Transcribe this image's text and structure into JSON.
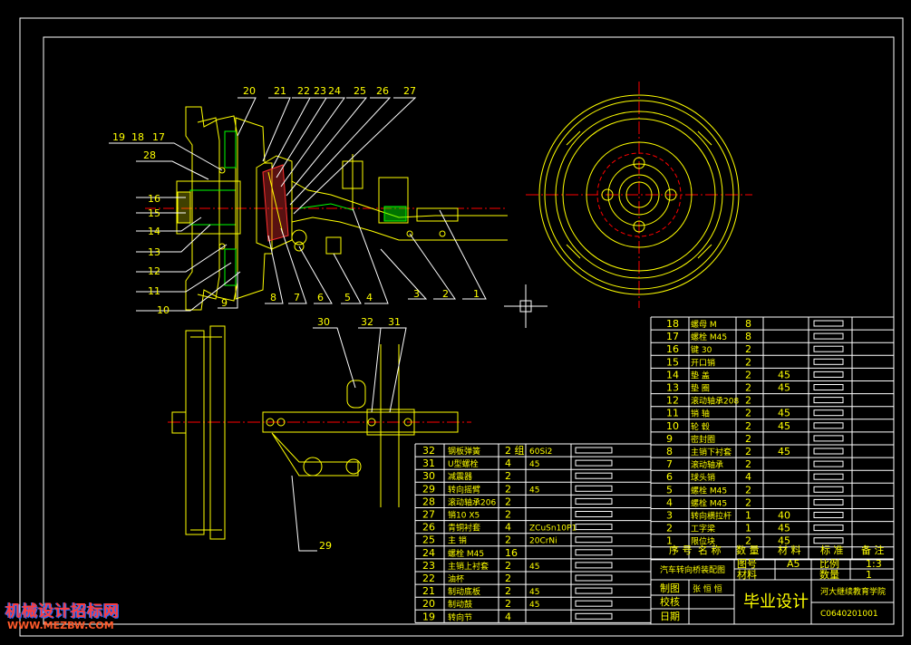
{
  "drawing": {
    "balloons_top": [
      "20",
      "21",
      "22",
      "23",
      "24",
      "25",
      "26",
      "27"
    ],
    "balloons_left": [
      "19",
      "18",
      "17",
      "28",
      "16",
      "15",
      "14",
      "13",
      "12",
      "11",
      "10"
    ],
    "balloons_bottom": [
      "9",
      "8",
      "7",
      "6",
      "5",
      "4",
      "3",
      "2",
      "1"
    ],
    "balloons_lower": [
      "30",
      "32",
      "31",
      "29"
    ]
  },
  "parts_right": [
    {
      "no": "18",
      "name": "螺母 M",
      "qty": "8",
      "mat": "",
      "std": "",
      "note": ""
    },
    {
      "no": "17",
      "name": "螺栓 M45",
      "qty": "8",
      "mat": "",
      "std": "",
      "note": ""
    },
    {
      "no": "16",
      "name": "键 30",
      "qty": "2",
      "mat": "",
      "std": "",
      "note": ""
    },
    {
      "no": "15",
      "name": "开口销",
      "qty": "2",
      "mat": "",
      "std": "",
      "note": ""
    },
    {
      "no": "14",
      "name": "垫 盖",
      "qty": "2",
      "mat": "45",
      "std": "",
      "note": ""
    },
    {
      "no": "13",
      "name": "垫 圈",
      "qty": "2",
      "mat": "45",
      "std": "",
      "note": ""
    },
    {
      "no": "12",
      "name": "滚动轴承208",
      "qty": "2",
      "mat": "",
      "std": "",
      "note": ""
    },
    {
      "no": "11",
      "name": "销 轴",
      "qty": "2",
      "mat": "45",
      "std": "",
      "note": ""
    },
    {
      "no": "10",
      "name": "轮 毂",
      "qty": "2",
      "mat": "45",
      "std": "",
      "note": ""
    },
    {
      "no": "9",
      "name": "密封圈",
      "qty": "2",
      "mat": "",
      "std": "",
      "note": ""
    },
    {
      "no": "8",
      "name": "主销下衬套",
      "qty": "2",
      "mat": "45",
      "std": "",
      "note": ""
    },
    {
      "no": "7",
      "name": "滚动轴承",
      "qty": "2",
      "mat": "",
      "std": "",
      "note": ""
    },
    {
      "no": "6",
      "name": "球头销",
      "qty": "4",
      "mat": "",
      "std": "",
      "note": ""
    },
    {
      "no": "5",
      "name": "螺栓 M45",
      "qty": "2",
      "mat": "",
      "std": "",
      "note": ""
    },
    {
      "no": "4",
      "name": "螺栓 M45",
      "qty": "2",
      "mat": "",
      "std": "",
      "note": ""
    },
    {
      "no": "3",
      "name": "转向横拉杆",
      "qty": "1",
      "mat": "40",
      "std": "",
      "note": ""
    },
    {
      "no": "2",
      "name": "工字梁",
      "qty": "1",
      "mat": "45",
      "std": "",
      "note": ""
    },
    {
      "no": "1",
      "name": "限位块",
      "qty": "2",
      "mat": "45",
      "std": "",
      "note": ""
    }
  ],
  "parts_left": [
    {
      "no": "32",
      "name": "钢板弹簧",
      "qty": "2 组",
      "mat": "60Si2"
    },
    {
      "no": "31",
      "name": "U型螺栓",
      "qty": "4",
      "mat": "45"
    },
    {
      "no": "30",
      "name": "减震器",
      "qty": "2",
      "mat": ""
    },
    {
      "no": "29",
      "name": "转向摇臂",
      "qty": "2",
      "mat": "45"
    },
    {
      "no": "28",
      "name": "滚动轴承206",
      "qty": "2",
      "mat": ""
    },
    {
      "no": "27",
      "name": "销10 X5",
      "qty": "2",
      "mat": ""
    },
    {
      "no": "26",
      "name": "青铜衬套",
      "qty": "4",
      "mat": "ZCuSn10P1"
    },
    {
      "no": "25",
      "name": "主 销",
      "qty": "2",
      "mat": "20CrNi"
    },
    {
      "no": "24",
      "name": "螺栓 M45",
      "qty": "16",
      "mat": ""
    },
    {
      "no": "23",
      "name": "主销上衬套",
      "qty": "2",
      "mat": "45"
    },
    {
      "no": "22",
      "name": "油杯",
      "qty": "2",
      "mat": ""
    },
    {
      "no": "21",
      "name": "制动底板",
      "qty": "2",
      "mat": "45"
    },
    {
      "no": "20",
      "name": "制动鼓",
      "qty": "2",
      "mat": "45"
    },
    {
      "no": "19",
      "name": "转向节",
      "qty": "4",
      "mat": ""
    }
  ],
  "header_row": {
    "no": "序 号",
    "name": "名 称",
    "qty": "数 量",
    "mat": "材 料",
    "std": "标 准",
    "note": "备 注"
  },
  "title_block": {
    "drawing_title": "汽车转向桥装配图",
    "fig_no_label": "图号",
    "fig_no": "A5",
    "scale_label": "比例",
    "scale": "1:3",
    "material_label": "材料",
    "qty_label": "数量",
    "qty": "1",
    "draw_label": "制图",
    "draw_name": "张 恒 恒",
    "check_label": "校核",
    "date_label": "日期",
    "project": "毕业设计",
    "school": "河大继续教育学院",
    "code": "C0640201001"
  },
  "watermark": {
    "name": "机械设计招标网",
    "url": "WWW.MEZBW.COM"
  },
  "colors": {
    "frame": "#ffffff",
    "yellow": "#ffff00",
    "green": "#00ff00",
    "red": "#ff0000",
    "background": "#000000"
  }
}
